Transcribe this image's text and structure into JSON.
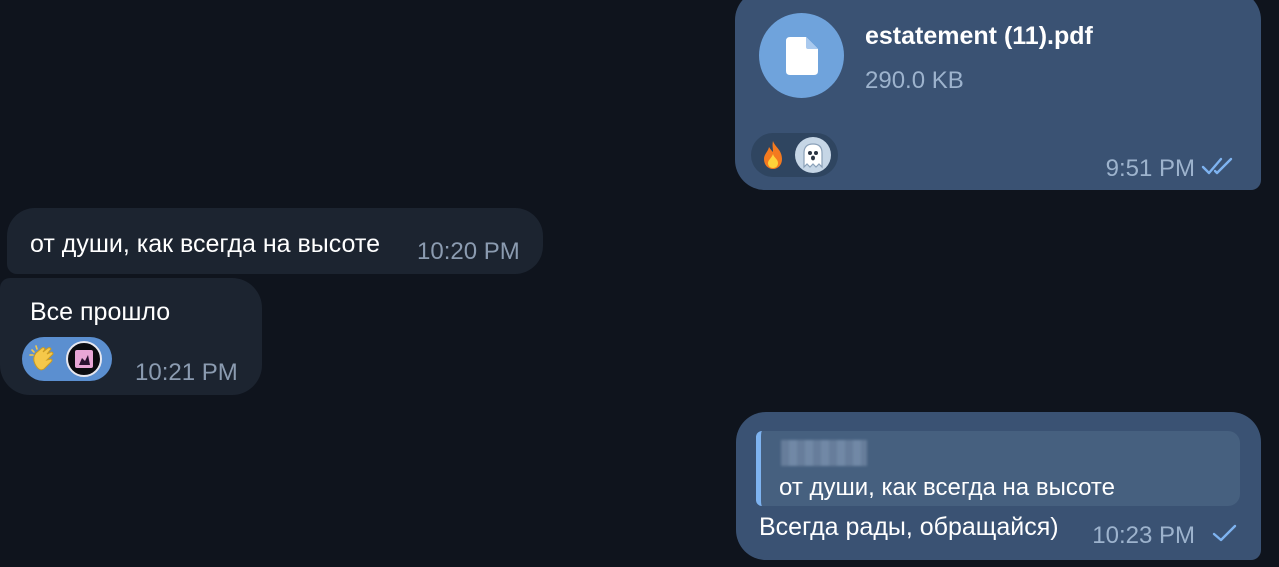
{
  "colors": {
    "background": "#0f141d",
    "outgoing_bubble": "#3a5273",
    "incoming_bubble": "#1c2430",
    "accent": "#6fa3dc",
    "meta_text": "#8b9bb0"
  },
  "messages": [
    {
      "direction": "outgoing",
      "type": "file",
      "file_name": "estatement (11).pdf",
      "file_size": "290.0 KB",
      "file_icon": "document-icon",
      "reactions": [
        "fire-emoji",
        "ghost-emoji"
      ],
      "time": "9:51 PM",
      "status": "read-double-check"
    },
    {
      "direction": "incoming",
      "type": "text",
      "text": "от души, как всегда на высоте",
      "time": "10:20 PM"
    },
    {
      "direction": "incoming",
      "type": "text",
      "text": "Все прошло",
      "reactions": [
        "clapping-hands-emoji",
        "user-avatar-reaction"
      ],
      "time": "10:21 PM"
    },
    {
      "direction": "outgoing",
      "type": "reply",
      "quote_text": "от души, как всегда на высоте",
      "text": "Всегда рады, обращайся)",
      "time": "10:23 PM",
      "status": "sent-single-check"
    }
  ]
}
